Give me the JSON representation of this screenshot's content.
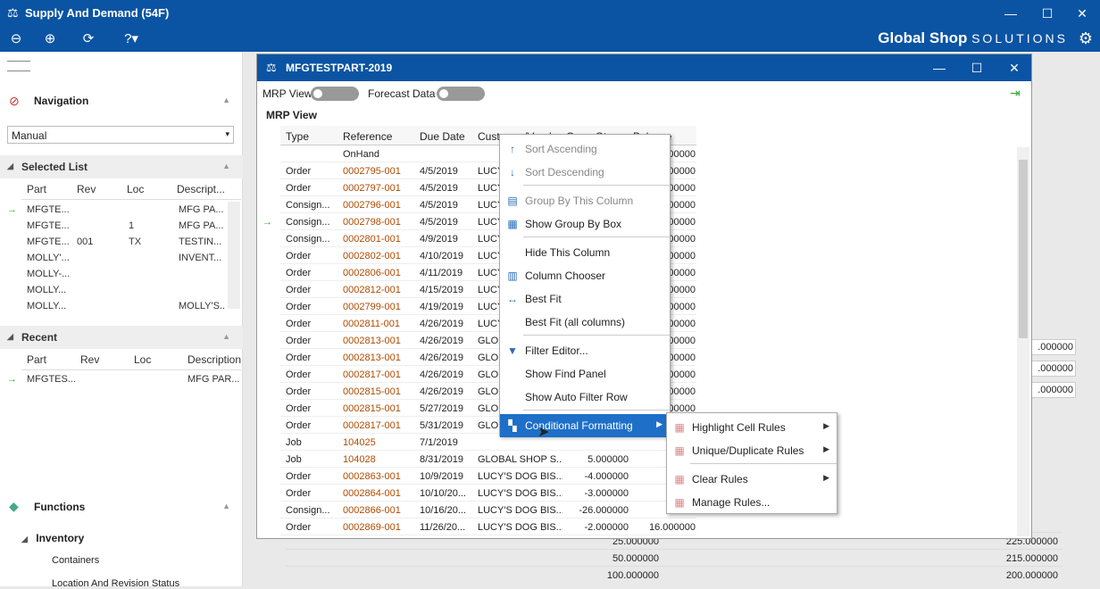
{
  "window": {
    "title": "Supply And Demand (54F)"
  },
  "brand": {
    "name": "Global Shop",
    "suffix": "SOLUTIONS"
  },
  "sidebar": {
    "navigation_title": "Navigation",
    "nav_select": "Manual",
    "selected_list_title": "Selected List",
    "selected_cols": [
      "Part",
      "Rev",
      "Loc",
      "Descript..."
    ],
    "selected_rows": [
      [
        "MFGTE...",
        "",
        "",
        "MFG PA..."
      ],
      [
        "MFGTE...",
        "",
        "1",
        "MFG PA..."
      ],
      [
        "MFGTE...",
        "001",
        "TX",
        "TESTIN..."
      ],
      [
        "MOLLY'...",
        "",
        "",
        "INVENT..."
      ],
      [
        "MOLLY-...",
        "",
        "",
        ""
      ],
      [
        "MOLLY...",
        "",
        "",
        ""
      ],
      [
        "MOLLY...",
        "",
        "",
        "MOLLY'S..."
      ]
    ],
    "recent_title": "Recent",
    "recent_cols": [
      "Part",
      "Rev",
      "Loc",
      "Description"
    ],
    "recent_rows": [
      [
        "MFGTES...",
        "",
        "",
        "MFG PAR..."
      ]
    ],
    "functions_title": "Functions",
    "inventory_title": "Inventory",
    "function_items": [
      "Containers",
      "Location And Revision Status"
    ]
  },
  "dialog": {
    "title": "MFGTESTPART-2019",
    "mrp_view_toggle": "MRP View",
    "forecast_toggle": "Forecast Data",
    "section_label": "MRP View",
    "columns": [
      "Type",
      "Reference",
      "Due Date",
      "Customer/Vendor",
      "Open Qty",
      "Balance"
    ],
    "rows": [
      [
        "",
        "OnHand",
        "",
        "",
        "",
        ".000000"
      ],
      [
        "Order",
        "0002795-001",
        "4/5/2019",
        "LUCY",
        "",
        ".000000"
      ],
      [
        "Order",
        "0002797-001",
        "4/5/2019",
        "LUCY",
        "",
        ".000000"
      ],
      [
        "Consign...",
        "0002796-001",
        "4/5/2019",
        "LUCY",
        "",
        ".000000"
      ],
      [
        "Consign...",
        "0002798-001",
        "4/5/2019",
        "LUCY",
        "",
        ".000000"
      ],
      [
        "Consign...",
        "0002801-001",
        "4/9/2019",
        "LUCY",
        "",
        ".000000"
      ],
      [
        "Order",
        "0002802-001",
        "4/10/2019",
        "LUCY",
        "",
        ".000000"
      ],
      [
        "Order",
        "0002806-001",
        "4/11/2019",
        "LUCY",
        "",
        ".000000"
      ],
      [
        "Order",
        "0002812-001",
        "4/15/2019",
        "LUCY",
        "",
        ".000000"
      ],
      [
        "Order",
        "0002799-001",
        "4/19/2019",
        "LUCY",
        "",
        ".000000"
      ],
      [
        "Order",
        "0002811-001",
        "4/26/2019",
        "LUCY",
        "",
        ".000000"
      ],
      [
        "Order",
        "0002813-001",
        "4/26/2019",
        "GLOB",
        "",
        ".000000"
      ],
      [
        "Order",
        "0002813-001",
        "4/26/2019",
        "GLOB",
        "",
        ".000000"
      ],
      [
        "Order",
        "0002817-001",
        "4/26/2019",
        "GLOB",
        "",
        ".000000"
      ],
      [
        "Order",
        "0002815-001",
        "4/26/2019",
        "GLOB",
        "",
        ".000000"
      ],
      [
        "Order",
        "0002815-001",
        "5/27/2019",
        "GLOB",
        "",
        ".000000"
      ],
      [
        "Order",
        "0002817-001",
        "5/31/2019",
        "GLOB",
        "",
        ".000000"
      ],
      [
        "Job",
        "104025",
        "7/1/2019",
        "",
        "",
        "46.00"
      ],
      [
        "Job",
        "104028",
        "8/31/2019",
        "GLOBAL SHOP S...",
        "5.000000",
        "51.00"
      ],
      [
        "Order",
        "0002863-001",
        "10/9/2019",
        "LUCY'S DOG BIS...",
        "-4.000000",
        "47.00"
      ],
      [
        "Order",
        "0002864-001",
        "10/10/20...",
        "LUCY'S DOG BIS...",
        "-3.000000",
        "44.00"
      ],
      [
        "Consign...",
        "0002866-001",
        "10/16/20...",
        "LUCY'S DOG BIS...",
        "-26.000000",
        "18.00"
      ],
      [
        "Order",
        "0002869-001",
        "11/26/20...",
        "LUCY'S DOG BIS...",
        "-2.000000",
        "16.000000"
      ]
    ]
  },
  "background_rows": [
    [
      "25.000000",
      "225.000000"
    ],
    [
      "50.000000",
      "215.000000"
    ],
    [
      "100.000000",
      "200.000000"
    ]
  ],
  "right_fields": [
    ".000000",
    ".000000",
    ".000000"
  ],
  "context_menu": {
    "items": [
      {
        "label": "Sort Ascending",
        "icon": "sort-ascending-icon",
        "disabled": true
      },
      {
        "label": "Sort Descending",
        "icon": "sort-descending-icon",
        "disabled": true
      },
      {
        "label": "Group By This Column",
        "icon": "group-icon",
        "disabled": true
      },
      {
        "label": "Show Group By Box",
        "icon": "group-box-icon",
        "disabled": false
      },
      {
        "label": "Hide This Column",
        "icon": "",
        "disabled": false
      },
      {
        "label": "Column Chooser",
        "icon": "column-chooser-icon",
        "disabled": false
      },
      {
        "label": "Best Fit",
        "icon": "best-fit-icon",
        "disabled": false
      },
      {
        "label": "Best Fit (all columns)",
        "icon": "",
        "disabled": false
      },
      {
        "label": "Filter Editor...",
        "icon": "filter-icon",
        "disabled": false
      },
      {
        "label": "Show Find Panel",
        "icon": "",
        "disabled": false
      },
      {
        "label": "Show Auto Filter Row",
        "icon": "",
        "disabled": false
      },
      {
        "label": "Conditional Formatting",
        "icon": "conditional-formatting-icon",
        "disabled": false
      }
    ]
  },
  "submenu": {
    "items": [
      "Highlight Cell Rules",
      "Unique/Duplicate Rules",
      "Clear Rules",
      "Manage Rules..."
    ]
  }
}
